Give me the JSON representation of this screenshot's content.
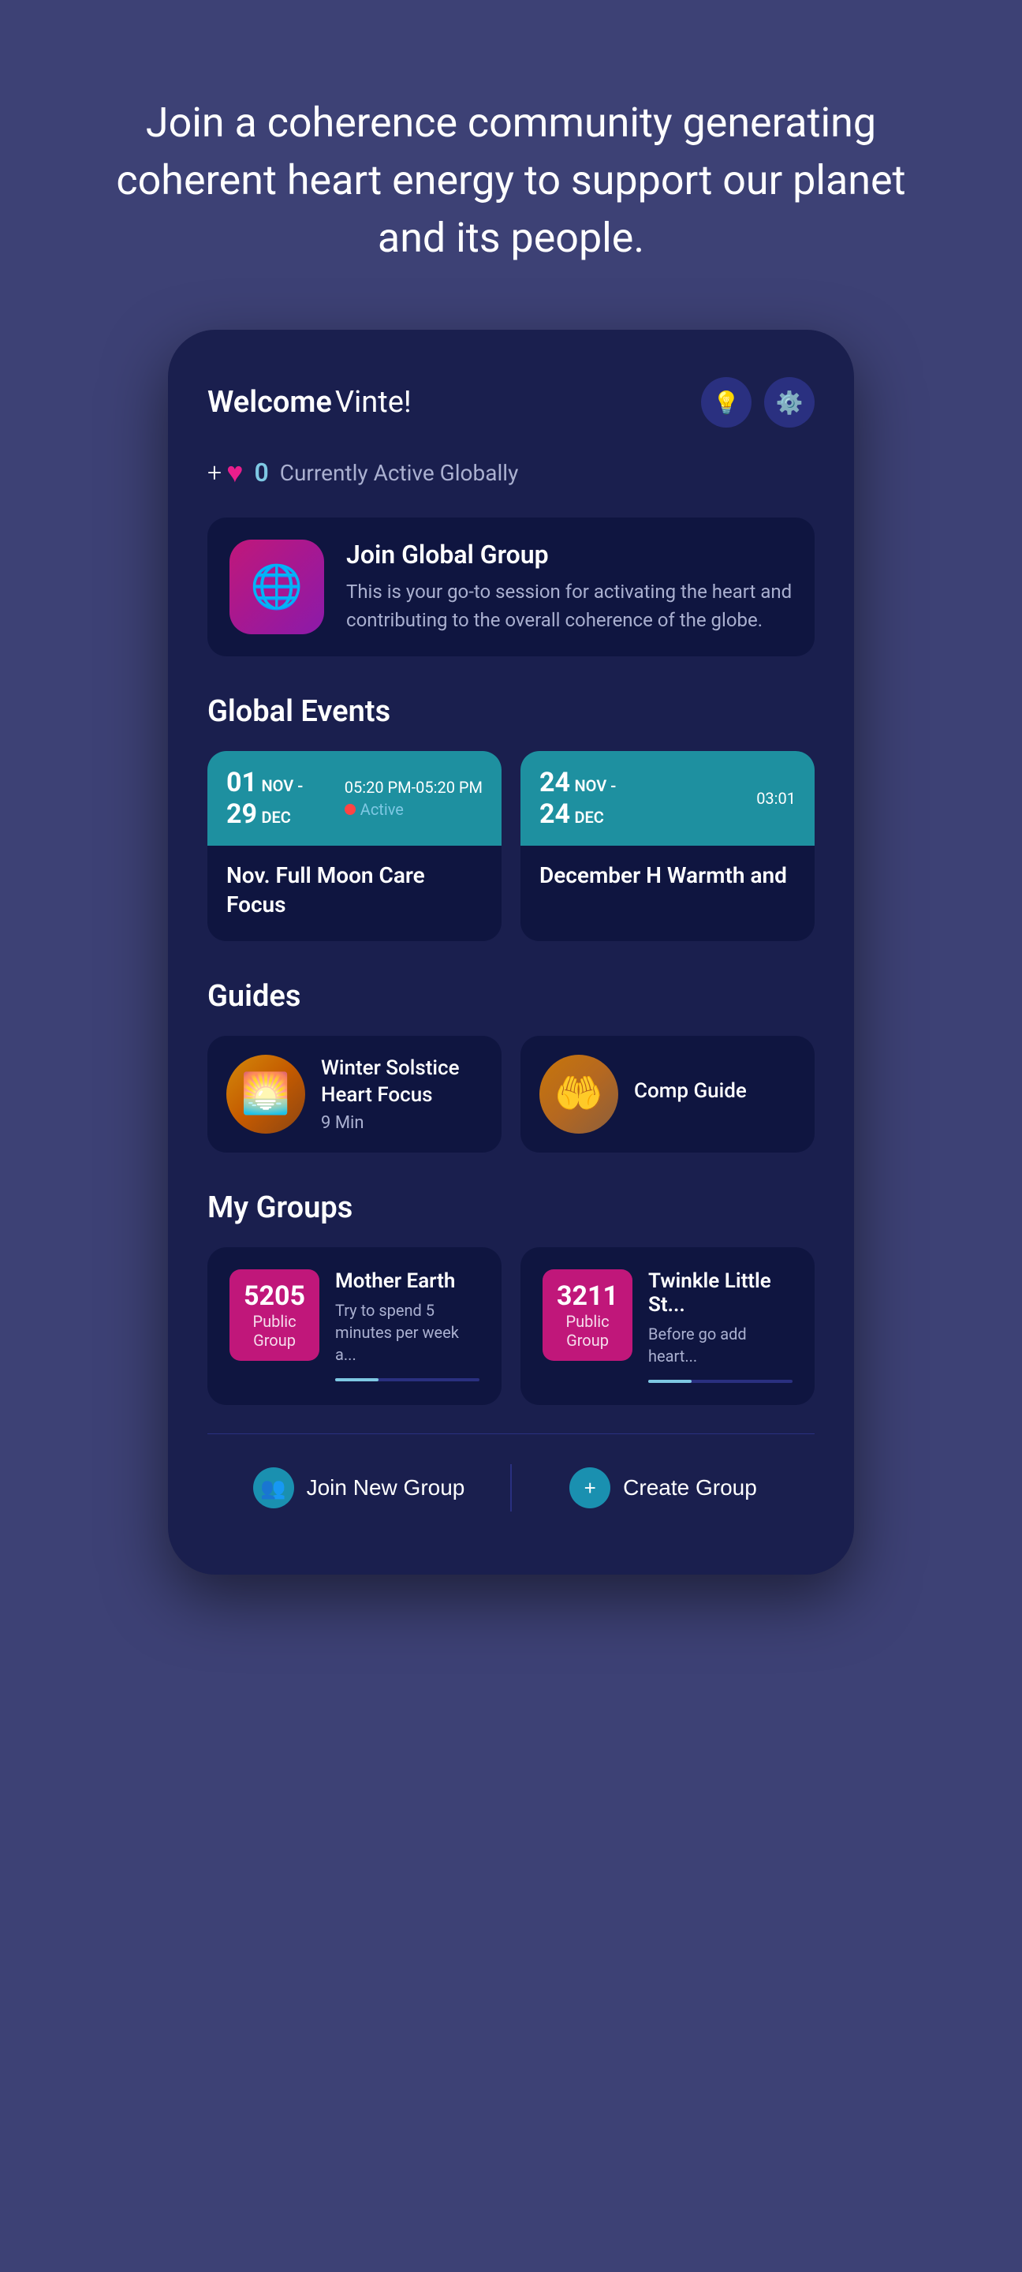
{
  "hero": {
    "text": "Join a coherence community generating coherent heart energy to support our planet and its people."
  },
  "app": {
    "welcome_prefix": "Welcome",
    "user_name": "Vinte!",
    "active_count": "0",
    "active_label": "Currently Active Globally",
    "global_group": {
      "title": "Join Global Group",
      "description": "This is your go-to session for activating the heart and contributing to the overall coherence of the globe."
    },
    "global_events_title": "Global Events",
    "events": [
      {
        "date_range": "01 NOV - 29 DEC",
        "day_start": "01",
        "month_start": "NOV",
        "day_end": "29",
        "month_end": "DEC",
        "time": "05:20 PM-05:20 PM",
        "status": "Active",
        "title": "Nov. Full Moon Care Focus"
      },
      {
        "date_range": "24 NOV - 24 DEC",
        "day_start": "24",
        "month_start": "NOV",
        "day_end": "24",
        "month_end": "DEC",
        "time": "03:01",
        "status": "",
        "title": "December H Warmth and"
      }
    ],
    "guides_title": "Guides",
    "guides": [
      {
        "title": "Winter Solstice Heart Focus",
        "duration": "9 Min",
        "thumb_type": "sunset"
      },
      {
        "title": "Comp Guide",
        "duration": "",
        "thumb_type": "hands"
      }
    ],
    "my_groups_title": "My Groups",
    "groups": [
      {
        "number": "5205",
        "type_line1": "Public",
        "type_line2": "Group",
        "name": "Mother Earth",
        "description": "Try to spend 5 minutes per week a..."
      },
      {
        "number": "3211",
        "type_line1": "Public",
        "type_line2": "Group",
        "name": "Twinkle Little St...",
        "description": "Before go add heart..."
      }
    ],
    "join_new_group_label": "Join New Group",
    "create_group_label": "Create Group"
  }
}
